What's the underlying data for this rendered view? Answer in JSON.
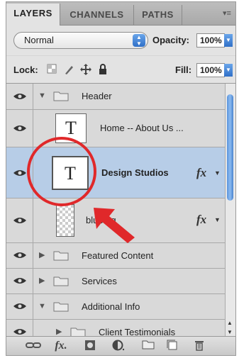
{
  "tabs": [
    "LAYERS",
    "CHANNELS",
    "PATHS"
  ],
  "panel_menu_glyph": "▾≡",
  "blend_mode": "Normal",
  "opacity": {
    "label": "Opacity:",
    "value": "100%"
  },
  "lock": {
    "label": "Lock:"
  },
  "fill": {
    "label": "Fill:",
    "value": "100%"
  },
  "layers": [
    {
      "name": "Header",
      "kind": "group",
      "expanded": true
    },
    {
      "name": "Home  --  About Us ...",
      "kind": "text"
    },
    {
      "name": "Design Studios",
      "kind": "text",
      "selected": true,
      "fx": "fx"
    },
    {
      "name": "blue bg",
      "kind": "pixel",
      "fx": "fx"
    },
    {
      "name": "Featured Content",
      "kind": "group",
      "expanded": false
    },
    {
      "name": "Services",
      "kind": "group",
      "expanded": false
    },
    {
      "name": "Additional Info",
      "kind": "group",
      "expanded": true
    },
    {
      "name": "Client Testimonials",
      "kind": "group",
      "expanded": false
    }
  ],
  "thumb_text_glyph": "T",
  "colors": {
    "selection": "#b7cde7",
    "annotation": "#e0282a",
    "accent": "#3a7bd5"
  }
}
